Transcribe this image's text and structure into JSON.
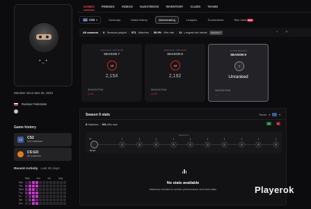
{
  "profile": {
    "username": "•_•",
    "member_since": "Member since Mar 25, 2023",
    "country": "Russian Federation"
  },
  "game_history": {
    "title": "Game history",
    "games": [
      {
        "icon": "cs2-icon",
        "name": "CS2",
        "matches": "414 matches",
        "color": "#3f5b9c"
      },
      {
        "icon": "cs-go-icon",
        "name": "CS:GO",
        "matches": "60 matches",
        "color": "#e07b1a"
      }
    ]
  },
  "recent_activity": {
    "title": "Recent Activity",
    "subtitle": "Last 90 days",
    "months": [
      "May",
      "Jun",
      "Jul",
      "Aug"
    ],
    "days": [
      "Mon",
      "Tue",
      "Wed",
      "Thu",
      "Fri",
      "Sat",
      "Sun"
    ]
  },
  "nav": {
    "tabs": [
      "GAMES",
      "FRIENDS",
      "VIDEOS",
      "GUESTBOOK",
      "INVENTORY",
      "CLUBS",
      "TEAMS"
    ],
    "active": 0
  },
  "subnav": {
    "game_badge": "CS",
    "game": "CS2",
    "tabs": [
      "Summary",
      "Match history",
      "Matchmaking",
      "Leagues",
      "Tournaments",
      "Skin Vault"
    ],
    "active": 2,
    "beta_label": "Beta"
  },
  "stats_strip": {
    "label": "All seasons",
    "seasons_value": "6",
    "seasons_label": "Seasons played",
    "matches_value": "571",
    "matches_label": "Matches",
    "winrate_value": "56.0%",
    "winrate_label": "Win rate",
    "streak_value": "11",
    "streak_label": "Longest win streak",
    "streak_badge": "SEASON 7"
  },
  "seasons": [
    {
      "header": "ONE RANK • WIN RATE",
      "title": "SEASON 7",
      "rank": "10",
      "value": "2,154",
      "peak_label": "SEASON PEAK",
      "peak": "2,640"
    },
    {
      "header": "ONE RANK • WIN RATE",
      "title": "SEASON 8",
      "rank": "10",
      "value": "2,192",
      "peak_label": "SEASON PEAK",
      "peak": "2,640"
    },
    {
      "header": "ACTIVE SEASON",
      "title": "SEASON 9",
      "rank": "?",
      "value": "Unranked",
      "peak_label": "SEASON PEAK",
      "peak": "- - -"
    }
  ],
  "season9": {
    "title": "Season 9 stats",
    "matches_value": "0",
    "matches_label": "Matches",
    "winrate_value": "0%",
    "winrate_label": "Win rate",
    "ranks_label": "Ranks",
    "wins": "0",
    "losses": "0",
    "track_label": "SEASON 9",
    "start_top": "Elo",
    "start_label": "Reset",
    "no_stats_title": "No stats available",
    "no_stats_sub": "Matches needed to unlock performance and total stats"
  },
  "watermark": "Playerok"
}
